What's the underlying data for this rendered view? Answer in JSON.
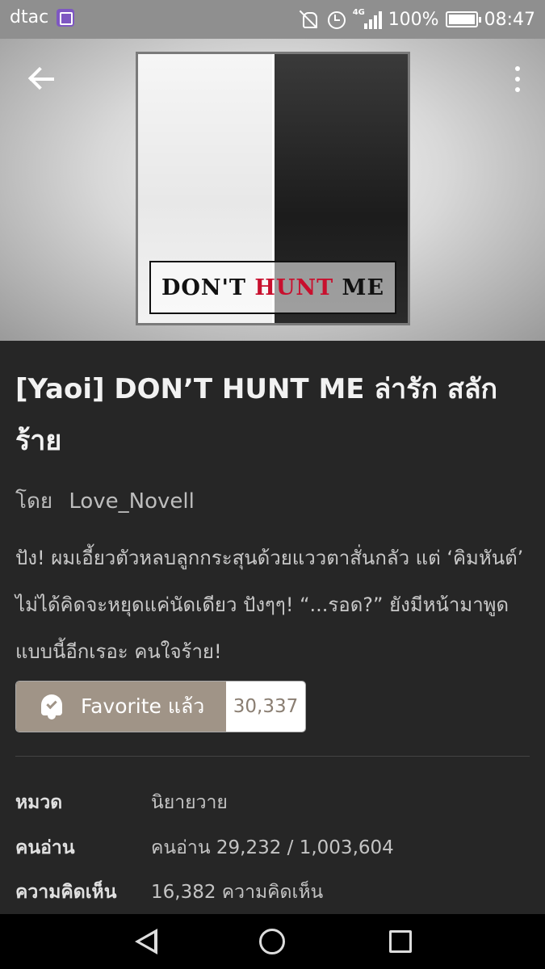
{
  "status_bar": {
    "carrier": "dtac",
    "battery": "100%",
    "time": "08:47",
    "network": "4G",
    "icons": [
      "image-notification-icon",
      "mute-icon",
      "alarm-icon",
      "signal-icon",
      "battery-icon"
    ]
  },
  "header": {
    "back_icon": "arrow-left-icon",
    "menu_icon": "more-vertical-icon",
    "cover": {
      "title_part1": "DON'T ",
      "title_part2": "HUNT",
      "title_part3": " ME"
    }
  },
  "story": {
    "title": "[Yaoi] DON’T HUNT ME ล่ารัก สลักร้าย",
    "author_prefix": "โดย",
    "author": "Love_Novell",
    "synopsis": "ปัง! ผมเอี้ยวตัวหลบลูกกระสุนด้วยแววตาสั่นกลัว แต่ ‘คิมหันต์’ ไม่ได้คิดจะหยุดแค่นัดเดียว ปังๆๆ! “...รอด?” ยังมีหน้ามาพูดแบบนี้อีกเรอะ คนใจร้าย!"
  },
  "favorite": {
    "label": "Favorite แล้ว",
    "count": "30,337",
    "icon": "bell-check-icon",
    "accent": "#a09487"
  },
  "info": [
    {
      "key": "หมวด",
      "value": "นิยายวาย"
    },
    {
      "key": "คนอ่าน",
      "value": "คนอ่าน 29,232 / 1,003,604"
    },
    {
      "key": "ความคิดเห็น",
      "value": "16,382 ความคิดเห็น"
    }
  ],
  "nav_bar": {
    "icons": [
      "nav-back-icon",
      "nav-home-icon",
      "nav-recent-icon"
    ]
  }
}
